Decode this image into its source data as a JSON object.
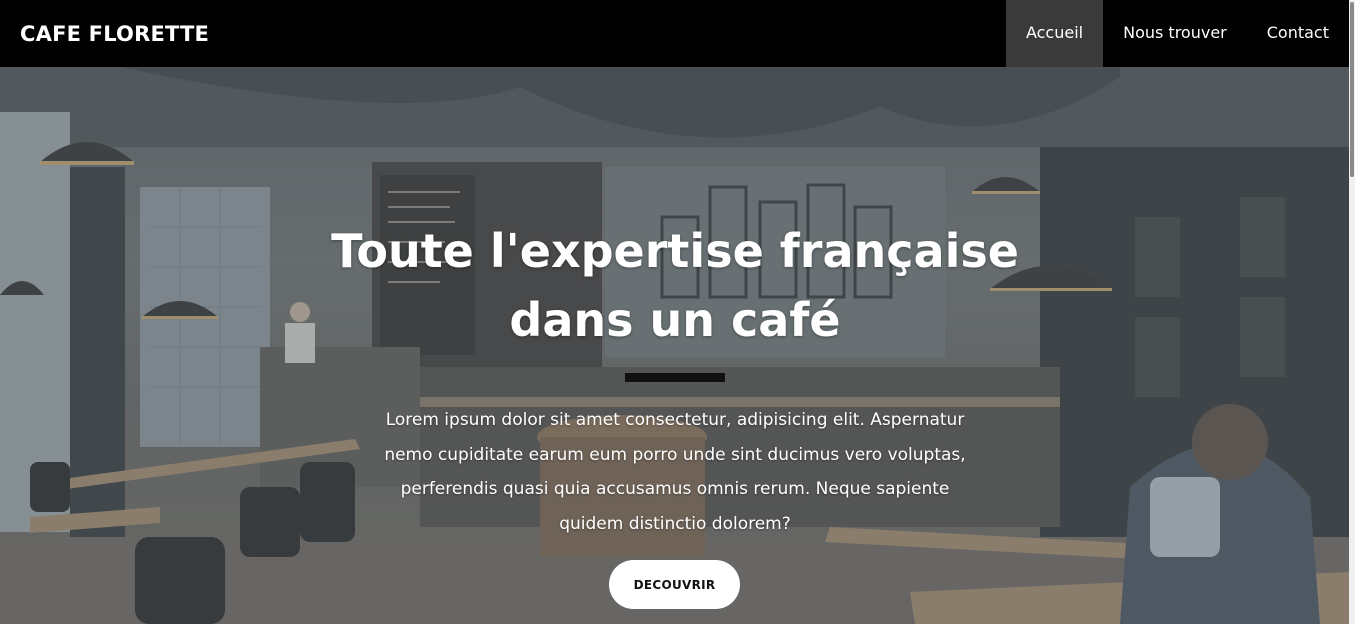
{
  "navbar": {
    "brand": "CAFE FLORETTE",
    "links": [
      {
        "label": "Accueil",
        "active": true
      },
      {
        "label": "Nous trouver",
        "active": false
      },
      {
        "label": "Contact",
        "active": false
      }
    ]
  },
  "hero": {
    "title": "Toute l'expertise française dans un café",
    "text": "Lorem ipsum dolor sit amet consectetur, adipisicing elit. Aspernatur nemo cupiditate earum eum porro unde sint ducimus vero voluptas, perferendis quasi quia accusamus omnis rerum. Neque sapiente quidem distinctio dolorem?",
    "cta_label": "DECOUVRIR"
  },
  "colors": {
    "navbar_bg": "#000000",
    "active_link_bg": "#3a3a3a",
    "divider": "#111111",
    "cta_bg": "#ffffff"
  }
}
